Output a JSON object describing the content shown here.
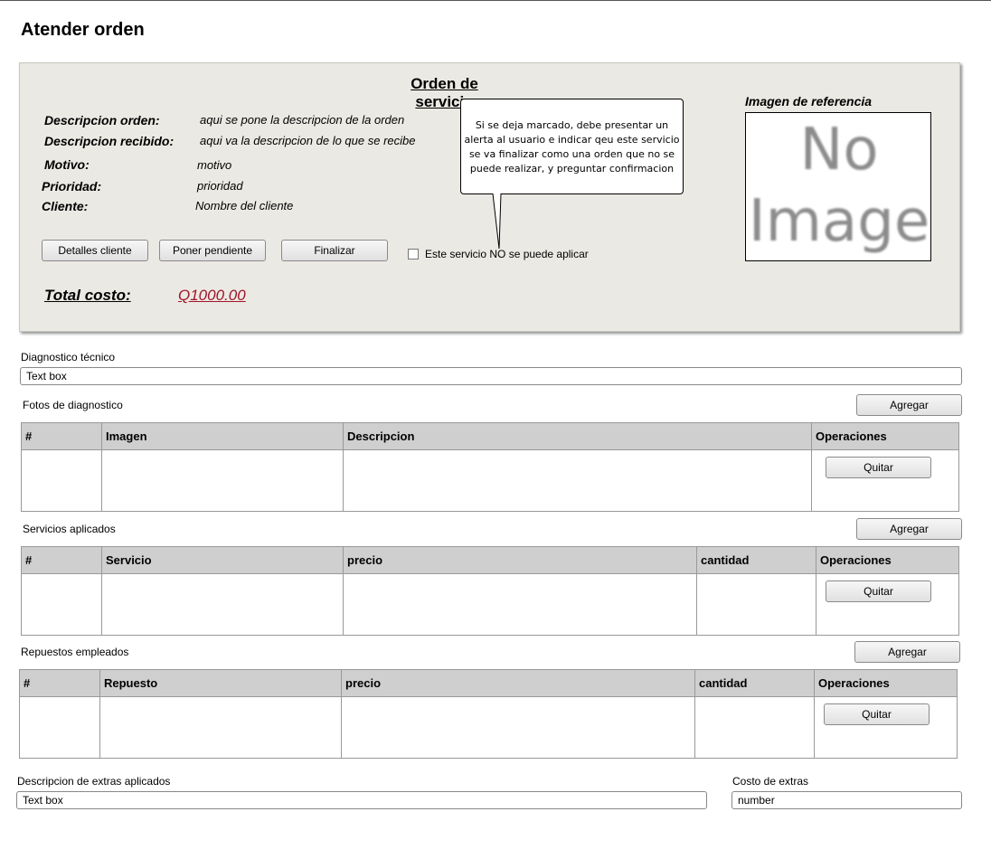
{
  "page": {
    "title": "Atender orden"
  },
  "order": {
    "title": "Orden de servicio",
    "fields": [
      {
        "label": "Descripcion orden:",
        "value": "aqui se pone la descripcion de la orden"
      },
      {
        "label": "Descripcion recibido:",
        "value": "aqui va la descripcion de lo que se recibe"
      },
      {
        "label": "Motivo:",
        "value": "motivo"
      },
      {
        "label": "Prioridad:",
        "value": "prioridad"
      },
      {
        "label": "Cliente:",
        "value": "Nombre del cliente"
      }
    ],
    "buttons": {
      "details": "Detalles cliente",
      "pending": "Poner pendiente",
      "finish": "Finalizar"
    },
    "callout": "Si se deja marcado, debe presentar un alerta al usuario e indicar qeu este servicio se va finalizar como una orden que no se puede realizar, y preguntar confirmacion",
    "checkbox_label": "Este servicio NO se puede aplicar",
    "total_label": "Total costo:",
    "total_value": "Q1000.00",
    "total_color": "#a0152a",
    "ref_label": "Imagen de referencia",
    "ref_placeholder_line1": "No",
    "ref_placeholder_line2": "Image"
  },
  "diagnostico": {
    "label": "Diagnostico técnico",
    "value": "Text box"
  },
  "fotos": {
    "label": "Fotos de diagnostico",
    "add_label": "Agregar",
    "columns": [
      "#",
      "Imagen",
      "Descripcion",
      "Operaciones"
    ],
    "remove_label": "Quitar"
  },
  "servicios": {
    "label": "Servicios aplicados",
    "add_label": "Agregar",
    "columns": [
      "#",
      "Servicio",
      "precio",
      "cantidad",
      "Operaciones"
    ],
    "remove_label": "Quitar"
  },
  "repuestos": {
    "label": "Repuestos empleados",
    "add_label": "Agregar",
    "columns": [
      "#",
      "Repuesto",
      "precio",
      "cantidad",
      "Operaciones"
    ],
    "remove_label": "Quitar"
  },
  "extras": {
    "desc_label": "Descripcion de extras aplicados",
    "desc_value": "Text box",
    "cost_label": "Costo de extras",
    "cost_value": "number"
  }
}
